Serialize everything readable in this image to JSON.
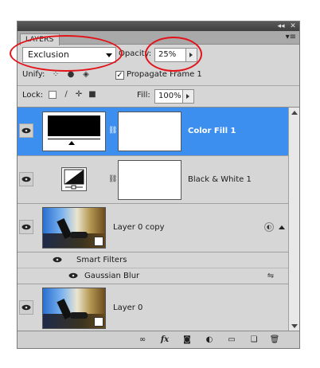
{
  "panel": {
    "tab_label": "LAYERS",
    "collapse_glyph": "◂◂",
    "close_glyph": "✕",
    "menu_glyph": "▾≡"
  },
  "controls": {
    "blend_mode": "Exclusion",
    "opacity_label": "Opacity:",
    "opacity_value": "25%",
    "unify_label": "Unify:",
    "propagate_label": "Propagate Frame 1",
    "propagate_checked": true,
    "lock_label": "Lock:",
    "fill_label": "Fill:",
    "fill_value": "100%"
  },
  "layers": [
    {
      "name": "Color Fill 1",
      "selected": true,
      "visible": true
    },
    {
      "name": "Black & White 1",
      "selected": false,
      "visible": true
    },
    {
      "name": "Layer 0 copy",
      "selected": false,
      "visible": true
    },
    {
      "name": "Layer 0",
      "selected": false,
      "visible": true
    }
  ],
  "smart_filters": {
    "label": "Smart Filters",
    "filters": [
      {
        "name": "Gaussian Blur"
      }
    ]
  },
  "icons": {
    "eye": "eye-icon",
    "link": "link-layers-icon",
    "fx": "fx",
    "mask": "add-mask-icon",
    "adjustment": "adjustment-layer-icon",
    "group": "folder-icon",
    "new": "new-layer-icon",
    "trash": "trash-icon"
  },
  "annotation_color": "#e2141a",
  "selection_color": "#3d8fef"
}
